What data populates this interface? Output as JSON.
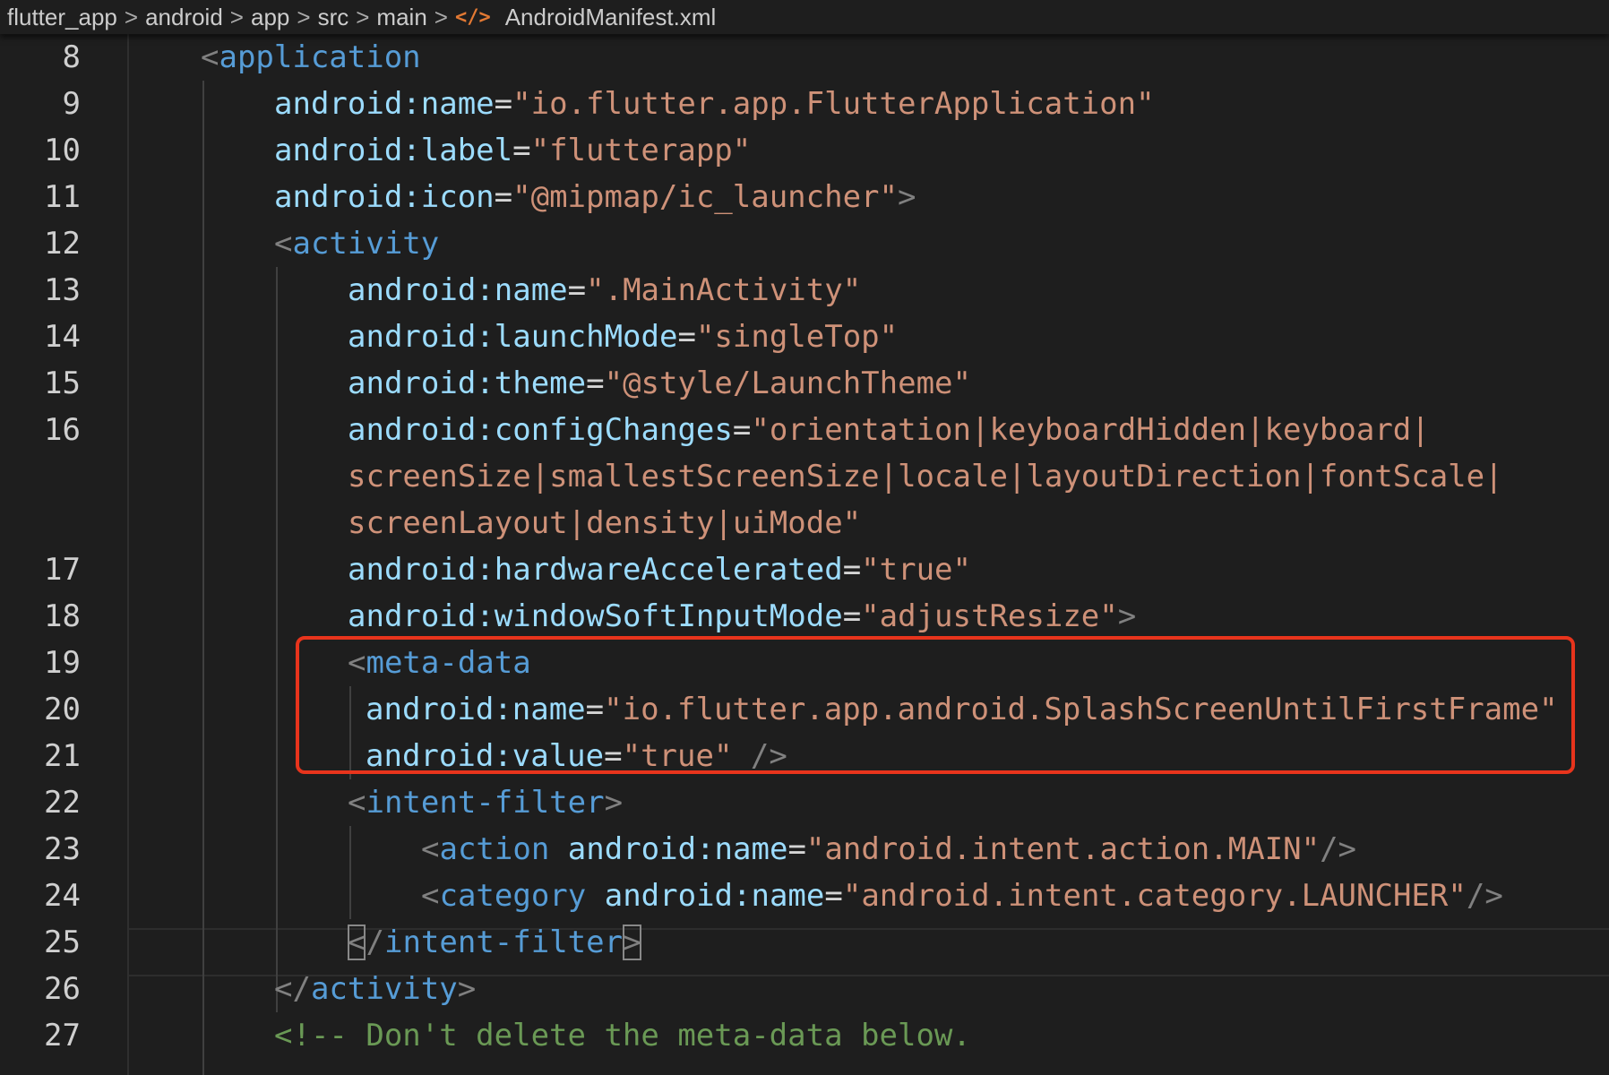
{
  "breadcrumb": {
    "items": [
      "flutter_app",
      "android",
      "app",
      "src",
      "main"
    ],
    "file_icon": "</>",
    "file": "AndroidManifest.xml"
  },
  "editor": {
    "line_numbers": [
      "8",
      "9",
      "10",
      "11",
      "12",
      "13",
      "14",
      "15",
      "16",
      "17",
      "18",
      "19",
      "20",
      "21",
      "22",
      "23",
      "24",
      "25",
      "26",
      "27"
    ],
    "lines": {
      "l8": {
        "open": "<",
        "tag": "application"
      },
      "l9": {
        "attr": "android:name",
        "eq": "=",
        "value": "\"io.flutter.app.FlutterApplication\""
      },
      "l10": {
        "attr": "android:label",
        "eq": "=",
        "value": "\"flutterapp\""
      },
      "l11": {
        "attr": "android:icon",
        "eq": "=",
        "value": "\"@mipmap/ic_launcher\"",
        "close": ">"
      },
      "l12": {
        "open": "<",
        "tag": "activity"
      },
      "l13": {
        "attr": "android:name",
        "eq": "=",
        "value": "\".MainActivity\""
      },
      "l14": {
        "attr": "android:launchMode",
        "eq": "=",
        "value": "\"singleTop\""
      },
      "l15": {
        "attr": "android:theme",
        "eq": "=",
        "value": "\"@style/LaunchTheme\""
      },
      "l16": {
        "attr": "android:configChanges",
        "eq": "=",
        "value_a": "\"orientation|keyboardHidden|keyboard|",
        "value_b": "screenSize|smallestScreenSize|locale|layoutDirection|fontScale|",
        "value_c": "screenLayout|density|uiMode\""
      },
      "l17": {
        "attr": "android:hardwareAccelerated",
        "eq": "=",
        "value": "\"true\""
      },
      "l18": {
        "attr": "android:windowSoftInputMode",
        "eq": "=",
        "value": "\"adjustResize\"",
        "close": ">"
      },
      "l19": {
        "open": "<",
        "tag": "meta-data"
      },
      "l20": {
        "attr": "android:name",
        "eq": "=",
        "value": "\"io.flutter.app.android.SplashScreenUntilFirstFrame\""
      },
      "l21": {
        "attr": "android:value",
        "eq": "=",
        "value": "\"true\"",
        "close": " />"
      },
      "l22": {
        "open": "<",
        "tag": "intent-filter",
        "close": ">"
      },
      "l23": {
        "open": "<",
        "tag": "action",
        "attr": "android:name",
        "eq": "=",
        "value": "\"android.intent.action.MAIN\"",
        "close": "/>"
      },
      "l24": {
        "open": "<",
        "tag": "category",
        "attr": "android:name",
        "eq": "=",
        "value": "\"android.intent.category.LAUNCHER\"",
        "close": "/>"
      },
      "l25": {
        "open": "<",
        "slash": "/",
        "tag": "intent-filter",
        "close": ">"
      },
      "l26": {
        "open": "</",
        "tag": "activity",
        "close": ">"
      },
      "l27": {
        "comment": "<!-- Don't delete the meta-data below."
      }
    }
  },
  "colors": {
    "background": "#1e1e1e",
    "tag": "#569cd6",
    "attribute": "#9cdcfe",
    "string": "#ce9178",
    "comment": "#6a9955",
    "punctuation": "#808080",
    "highlight_box": "#e8341c"
  }
}
